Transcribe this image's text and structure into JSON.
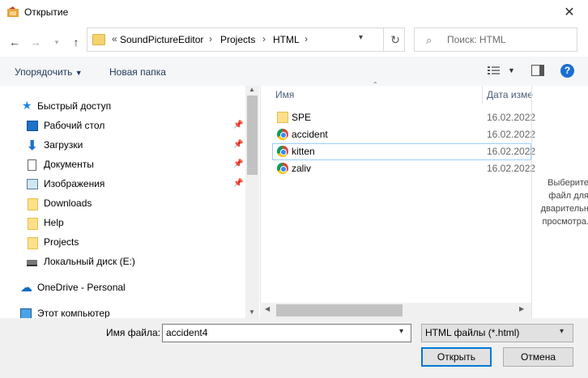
{
  "window": {
    "title": "Открытие"
  },
  "nav": {
    "address": {
      "overflow": "«",
      "crumbs": [
        "SoundPictureEditor",
        "Projects",
        "HTML"
      ]
    },
    "search_placeholder": "Поиск: HTML"
  },
  "toolbar": {
    "organize": "Упорядочить",
    "new_folder": "Новая папка"
  },
  "sidebar": {
    "items": [
      {
        "label": "Быстрый доступ",
        "icon": "star-icon"
      },
      {
        "label": "Рабочий стол",
        "icon": "desktop-icon",
        "pinned": true
      },
      {
        "label": "Загрузки",
        "icon": "download-arrow-icon",
        "pinned": true
      },
      {
        "label": "Документы",
        "icon": "document-icon",
        "pinned": true
      },
      {
        "label": "Изображения",
        "icon": "pictures-icon",
        "pinned": true
      },
      {
        "label": "Downloads",
        "icon": "folder-icon"
      },
      {
        "label": "Help",
        "icon": "folder-icon"
      },
      {
        "label": "Projects",
        "icon": "folder-icon"
      },
      {
        "label": "Локальный диск (E:)",
        "icon": "drive-icon"
      },
      {
        "label": "OneDrive - Personal",
        "icon": "cloud-icon"
      },
      {
        "label": "Этот компьютер",
        "icon": "computer-icon"
      }
    ]
  },
  "files": {
    "columns": {
      "name": "Имя",
      "date": "Дата изме"
    },
    "rows": [
      {
        "name": "SPE",
        "date": "16.02.2022",
        "icon": "folder-icon"
      },
      {
        "name": "accident",
        "date": "16.02.2022",
        "icon": "chrome-icon"
      },
      {
        "name": "kitten",
        "date": "16.02.2022",
        "icon": "chrome-icon",
        "selected": true
      },
      {
        "name": "zaliv",
        "date": "16.02.2022",
        "icon": "chrome-icon"
      }
    ]
  },
  "preview": {
    "line1": "Выберите",
    "line2": "файл для",
    "line3": "дварительн",
    "line4": "просмотра."
  },
  "footer": {
    "filename_label": "Имя файла:",
    "filename_value": "accident4",
    "filetype_value": "HTML файлы (*.html)",
    "open": "Открыть",
    "cancel": "Отмена"
  },
  "colors": {
    "accent": "#0078d7",
    "selection_border": "#99d1ff",
    "folder": "#ffe08a",
    "help": "#1c6fd1"
  }
}
